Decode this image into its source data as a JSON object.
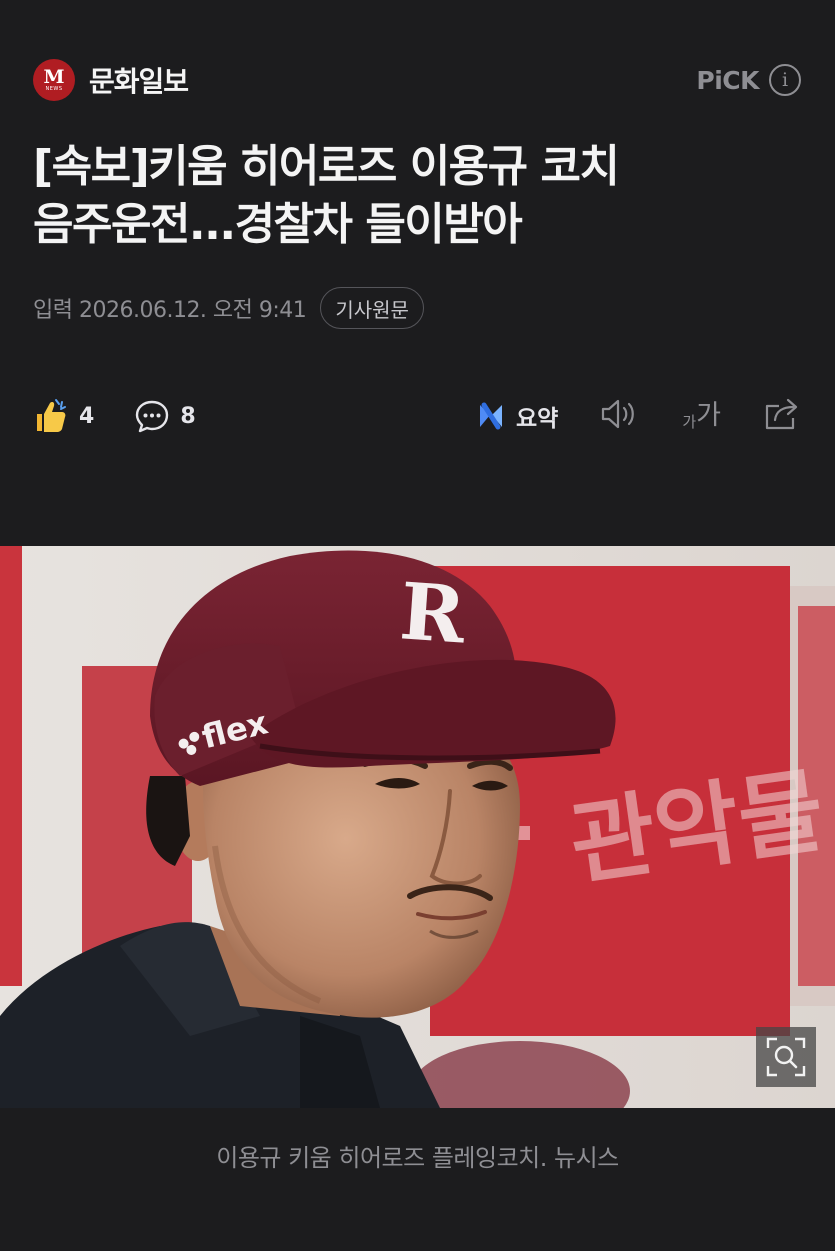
{
  "publisher": {
    "name": "문화일보",
    "logo_letter": "M",
    "logo_sub": "NEWS"
  },
  "pick": {
    "label": "PiCK",
    "info_icon": "i"
  },
  "article": {
    "title_line1": "[속보]키움 히어로즈 이용규 코치",
    "title_line2": "음주운전...경찰차 들이받아",
    "date": "입력 2026.06.12. 오전 9:41",
    "original_label": "기사원문"
  },
  "actions": {
    "like_count": "4",
    "comment_count": "8",
    "summary_label": "요약",
    "font_small": "가",
    "font_large": "가"
  },
  "photo": {
    "cap_letter": "R",
    "cap_logo_text": "flex",
    "background_sign_text": "관악물"
  },
  "caption": "이용규 키움 히어로즈 플레잉코치. 뉴시스",
  "colors": {
    "background": "#1c1c1e",
    "brand_red": "#b01d22",
    "cap_maroon": "#6e1f2c",
    "muted_text": "#8e8e93"
  }
}
